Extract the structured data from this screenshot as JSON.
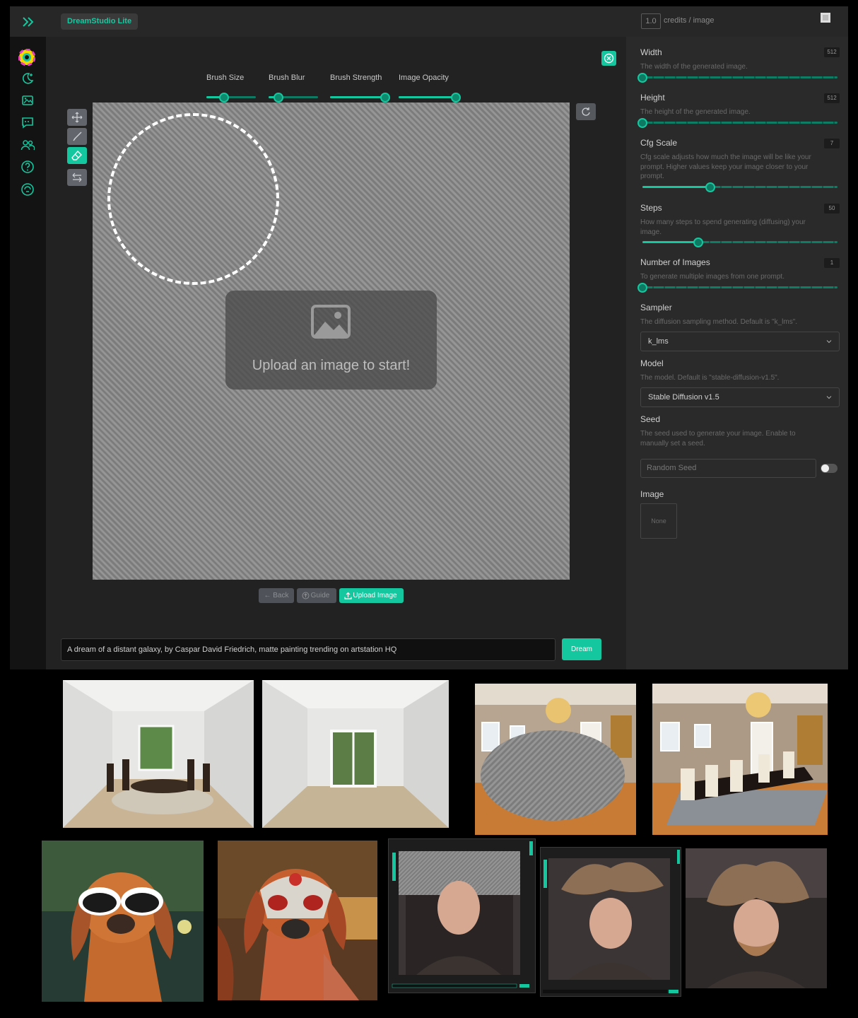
{
  "app": {
    "brand": "DreamStudio Lite",
    "credits_value": "1.0",
    "credits_label": "credits / image"
  },
  "sidebar": {
    "items": [
      "logo-icon",
      "dream-icon",
      "history-icon",
      "feedback-icon",
      "community-icon",
      "help-icon",
      "privacy-icon"
    ]
  },
  "brush_controls": [
    {
      "label": "Brush Size",
      "value": 0.35
    },
    {
      "label": "Brush Blur",
      "value": 0.2
    },
    {
      "label": "Brush Strength",
      "value": 1.0
    },
    {
      "label": "Image Opacity",
      "value": 1.0
    }
  ],
  "tools": [
    "move-icon",
    "brush-icon",
    "eraser-icon",
    "swap-icon"
  ],
  "canvas": {
    "upload_prompt": "Upload an image to start!"
  },
  "canvas_actions": {
    "back": "← Back",
    "guide": "Guide",
    "upload": "Upload Image"
  },
  "prompt": {
    "text": "A dream of a distant galaxy, by Caspar David Friedrich, matte painting trending on artstation HQ",
    "dream_button": "Dream"
  },
  "settings": {
    "width": {
      "label": "Width",
      "desc": "The width of the generated image.",
      "value": "512",
      "level": 0.0
    },
    "height": {
      "label": "Height",
      "desc": "The height of the generated image.",
      "value": "512",
      "level": 0.0
    },
    "cfg": {
      "label": "Cfg Scale",
      "desc": "Cfg scale adjusts how much the image will be like your prompt. Higher values keep your image closer to your prompt.",
      "value": "7",
      "level": 0.35
    },
    "steps": {
      "label": "Steps",
      "desc": "How many steps to spend generating (diffusing) your image.",
      "value": "50",
      "level": 0.28
    },
    "num_images": {
      "label": "Number of Images",
      "desc": "To generate multiple images from one prompt.",
      "value": "1",
      "level": 0.0
    },
    "sampler": {
      "label": "Sampler",
      "desc": "The diffusion sampling method. Default is \"k_lms\".",
      "value": "k_lms"
    },
    "model": {
      "label": "Model",
      "desc": "The model. Default is \"stable-diffusion-v1.5\".",
      "value": "Stable Diffusion v1.5"
    },
    "seed": {
      "label": "Seed",
      "desc": "The seed used to generate your image. Enable to manually set a seed.",
      "placeholder": "Random Seed"
    },
    "image": {
      "label": "Image",
      "value": "None"
    }
  },
  "colors": {
    "accent": "#14c79e",
    "panel": "#2a2a2a",
    "background": "#1f1f1f"
  }
}
